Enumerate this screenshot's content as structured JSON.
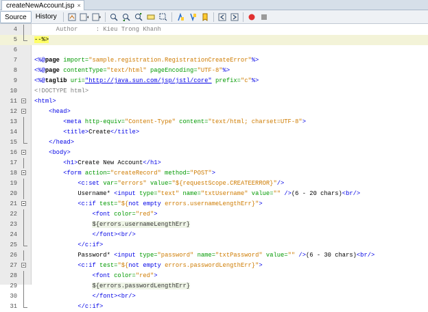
{
  "file_tab": {
    "name": "createNewAccount.jsp",
    "close": "×"
  },
  "view_tabs": [
    "Source",
    "History"
  ],
  "lines": [
    {
      "n": "4",
      "fold": "line",
      "parts": [
        {
          "t": "      Author     : Kieu Trong Khanh",
          "c": "g"
        }
      ]
    },
    {
      "n": "5",
      "fold": "end",
      "parts": [
        {
          "t": "--%>",
          "c": "mark"
        }
      ]
    },
    {
      "n": "6",
      "fold": "",
      "parts": []
    },
    {
      "n": "7",
      "fold": "",
      "parts": [
        {
          "t": "<%@",
          "c": "k"
        },
        {
          "t": "page",
          "c": "dir"
        },
        {
          "t": " import=",
          "c": "a"
        },
        {
          "t": "\"sample.registration.RegistrationCreateError\"",
          "c": "s"
        },
        {
          "t": "%>",
          "c": "k"
        }
      ]
    },
    {
      "n": "8",
      "fold": "",
      "parts": [
        {
          "t": "<%@",
          "c": "k"
        },
        {
          "t": "page",
          "c": "dir"
        },
        {
          "t": " contentType=",
          "c": "a"
        },
        {
          "t": "\"text/html\"",
          "c": "s"
        },
        {
          "t": " pageEncoding=",
          "c": "a"
        },
        {
          "t": "\"UTF-8\"",
          "c": "s"
        },
        {
          "t": "%>",
          "c": "k"
        }
      ]
    },
    {
      "n": "9",
      "fold": "",
      "parts": [
        {
          "t": "<%@",
          "c": "k"
        },
        {
          "t": "taglib",
          "c": "dir"
        },
        {
          "t": " uri=",
          "c": "a"
        },
        {
          "t": "\"http://java.sun.com/jsp/jstl/core\"",
          "c": "u"
        },
        {
          "t": " prefix=",
          "c": "a"
        },
        {
          "t": "\"c\"",
          "c": "s"
        },
        {
          "t": "%>",
          "c": "k"
        }
      ]
    },
    {
      "n": "10",
      "fold": "",
      "parts": [
        {
          "t": "<!DOCTYPE html>",
          "c": "g"
        }
      ]
    },
    {
      "n": "11",
      "fold": "box",
      "parts": [
        {
          "t": "<html>",
          "c": "k"
        }
      ]
    },
    {
      "n": "12",
      "fold": "box",
      "parts": [
        {
          "t": "    "
        },
        {
          "t": "<head>",
          "c": "k"
        }
      ]
    },
    {
      "n": "13",
      "fold": "line",
      "parts": [
        {
          "t": "        "
        },
        {
          "t": "<meta",
          "c": "k"
        },
        {
          "t": " http-equiv=",
          "c": "a"
        },
        {
          "t": "\"Content-Type\"",
          "c": "s"
        },
        {
          "t": " content=",
          "c": "a"
        },
        {
          "t": "\"text/html; charset=UTF-8\"",
          "c": "s"
        },
        {
          "t": ">",
          "c": "k"
        }
      ]
    },
    {
      "n": "14",
      "fold": "line",
      "parts": [
        {
          "t": "        "
        },
        {
          "t": "<title>",
          "c": "k"
        },
        {
          "t": "Create"
        },
        {
          "t": "</title>",
          "c": "k"
        }
      ]
    },
    {
      "n": "15",
      "fold": "end",
      "parts": [
        {
          "t": "    "
        },
        {
          "t": "</head>",
          "c": "k"
        }
      ]
    },
    {
      "n": "16",
      "fold": "box",
      "parts": [
        {
          "t": "    "
        },
        {
          "t": "<body>",
          "c": "k"
        }
      ]
    },
    {
      "n": "17",
      "fold": "line",
      "parts": [
        {
          "t": "        "
        },
        {
          "t": "<h1>",
          "c": "k"
        },
        {
          "t": "Create New Account"
        },
        {
          "t": "</h1>",
          "c": "k"
        }
      ]
    },
    {
      "n": "18",
      "fold": "box",
      "parts": [
        {
          "t": "        "
        },
        {
          "t": "<form",
          "c": "k"
        },
        {
          "t": " action=",
          "c": "a"
        },
        {
          "t": "\"createRecord\"",
          "c": "s"
        },
        {
          "t": " method=",
          "c": "a"
        },
        {
          "t": "\"POST\"",
          "c": "s"
        },
        {
          "t": ">",
          "c": "k"
        }
      ]
    },
    {
      "n": "19",
      "fold": "line",
      "parts": [
        {
          "t": "            "
        },
        {
          "t": "<c:set",
          "c": "k"
        },
        {
          "t": " var=",
          "c": "a"
        },
        {
          "t": "\"errors\"",
          "c": "s"
        },
        {
          "t": " value=",
          "c": "a"
        },
        {
          "t": "\"${requestScope.CREATEERROR}\"",
          "c": "s"
        },
        {
          "t": "/>",
          "c": "k"
        }
      ]
    },
    {
      "n": "20",
      "fold": "line",
      "parts": [
        {
          "t": "            Username* "
        },
        {
          "t": "<input",
          "c": "k"
        },
        {
          "t": " type=",
          "c": "a"
        },
        {
          "t": "\"text\"",
          "c": "s"
        },
        {
          "t": " name=",
          "c": "a"
        },
        {
          "t": "\"txtUsername\"",
          "c": "s"
        },
        {
          "t": " value=",
          "c": "a"
        },
        {
          "t": "\"\"",
          "c": "s"
        },
        {
          "t": " />",
          "c": "k"
        },
        {
          "t": "(6 - 20 chars)"
        },
        {
          "t": "<br/>",
          "c": "k"
        }
      ]
    },
    {
      "n": "21",
      "fold": "box",
      "parts": [
        {
          "t": "            "
        },
        {
          "t": "<c:if",
          "c": "k"
        },
        {
          "t": " test=",
          "c": "a"
        },
        {
          "t": "\"${",
          "c": "s"
        },
        {
          "t": "not empty",
          "c": "o"
        },
        {
          "t": " errors.usernameLengthErr}\"",
          "c": "s"
        },
        {
          "t": ">",
          "c": "k"
        }
      ]
    },
    {
      "n": "22",
      "fold": "line",
      "parts": [
        {
          "t": "                "
        },
        {
          "t": "<font",
          "c": "k"
        },
        {
          "t": " color=",
          "c": "a"
        },
        {
          "t": "\"red\"",
          "c": "s"
        },
        {
          "t": ">",
          "c": "k"
        }
      ]
    },
    {
      "n": "23",
      "fold": "line",
      "parts": [
        {
          "t": "                "
        },
        {
          "t": "${errors.usernameLengthErr}",
          "c": "el"
        }
      ]
    },
    {
      "n": "24",
      "fold": "line",
      "parts": [
        {
          "t": "                "
        },
        {
          "t": "</font>",
          "c": "k"
        },
        {
          "t": "<br/>",
          "c": "k"
        }
      ]
    },
    {
      "n": "25",
      "fold": "end",
      "parts": [
        {
          "t": "            "
        },
        {
          "t": "</c:if>",
          "c": "k"
        }
      ]
    },
    {
      "n": "26",
      "fold": "line",
      "parts": [
        {
          "t": "            Password* "
        },
        {
          "t": "<input",
          "c": "k"
        },
        {
          "t": " type=",
          "c": "a"
        },
        {
          "t": "\"password\"",
          "c": "s"
        },
        {
          "t": " name=",
          "c": "a"
        },
        {
          "t": "\"txtPassword\"",
          "c": "s"
        },
        {
          "t": " value=",
          "c": "a"
        },
        {
          "t": "\"\"",
          "c": "s"
        },
        {
          "t": " />",
          "c": "k"
        },
        {
          "t": "(6 - 30 chars)"
        },
        {
          "t": "<br/>",
          "c": "k"
        }
      ]
    },
    {
      "n": "27",
      "fold": "box",
      "parts": [
        {
          "t": "            "
        },
        {
          "t": "<c:if",
          "c": "k"
        },
        {
          "t": " test=",
          "c": "a"
        },
        {
          "t": "\"${",
          "c": "s"
        },
        {
          "t": "not empty",
          "c": "o"
        },
        {
          "t": " errors.passwordLengthErr}\"",
          "c": "s"
        },
        {
          "t": ">",
          "c": "k"
        }
      ]
    },
    {
      "n": "28",
      "fold": "line",
      "parts": [
        {
          "t": "                "
        },
        {
          "t": "<font",
          "c": "k"
        },
        {
          "t": " color=",
          "c": "a"
        },
        {
          "t": "\"red\"",
          "c": "s"
        },
        {
          "t": ">",
          "c": "k"
        }
      ]
    },
    {
      "n": "29",
      "fold": "line",
      "parts": [
        {
          "t": "                "
        },
        {
          "t": "${errors.passwordLengthErr}",
          "c": "el"
        }
      ]
    },
    {
      "n": "30",
      "fold": "line",
      "parts": [
        {
          "t": "                "
        },
        {
          "t": "</font>",
          "c": "k"
        },
        {
          "t": "<br/>",
          "c": "k"
        }
      ]
    },
    {
      "n": "31",
      "fold": "end",
      "parts": [
        {
          "t": "            "
        },
        {
          "t": "</c:if>",
          "c": "k"
        }
      ]
    }
  ],
  "colors": {
    "keyword": "#0000e6",
    "attribute": "#009900",
    "string": "#ce7b00",
    "comment": "#808080"
  },
  "toolbar_icons": [
    "last-edit-icon",
    "back-icon",
    "forward-icon",
    "find-selection-icon",
    "find-previous-icon",
    "find-next-icon",
    "toggle-highlight-icon",
    "toggle-rect-selection-icon",
    "previous-bookmark-icon",
    "next-bookmark-icon",
    "toggle-bookmark-icon",
    "shift-left-icon",
    "shift-right-icon",
    "start-macro-icon",
    "stop-macro-icon"
  ]
}
